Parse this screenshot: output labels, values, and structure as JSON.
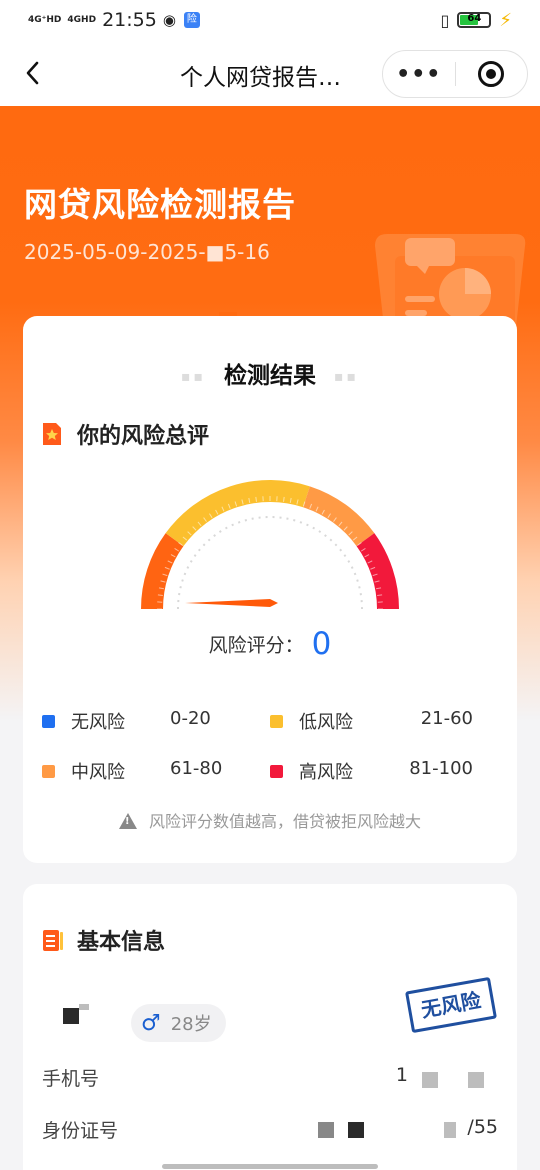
{
  "status_bar": {
    "signal1": "4G⁺HD",
    "signal2": "4GHD",
    "time": "21:55",
    "app_badge": "险",
    "battery": "64"
  },
  "nav": {
    "back_icon": "chevron-left-icon",
    "title": "个人网贷报告…",
    "more_icon": "more-dots-icon",
    "close_icon": "target-icon"
  },
  "hero": {
    "title": "网贷风险检测报告",
    "date_range": "2025-05-09-2025-■5-16"
  },
  "result_card": {
    "title": "检测结果",
    "section_title": "你的风险总评",
    "score_label": "风险评分：",
    "score_value": "0",
    "score_fraction": 0,
    "legend": [
      {
        "name": "无风险",
        "range": "0-20",
        "color": "#1f6ff0"
      },
      {
        "name": "低风险",
        "range": "21-60",
        "color": "#fbbf2e"
      },
      {
        "name": "中风险",
        "range": "61-80",
        "color": "#ff9a45"
      },
      {
        "name": "高风险",
        "range": "81-100",
        "color": "#f2193b"
      }
    ],
    "note": "风险评分数值越高，借贷被拒风险越大"
  },
  "info_card": {
    "section_title": "基本信息",
    "age": "28岁",
    "stamp": "无风险",
    "phone_label": "手机号",
    "phone_value": "1",
    "id_label": "身份证号",
    "id_value": "/55"
  },
  "colors": {
    "brand_orange": "#ff6a10",
    "score_blue": "#2070f0",
    "stamp_blue": "#1f4f9f"
  }
}
